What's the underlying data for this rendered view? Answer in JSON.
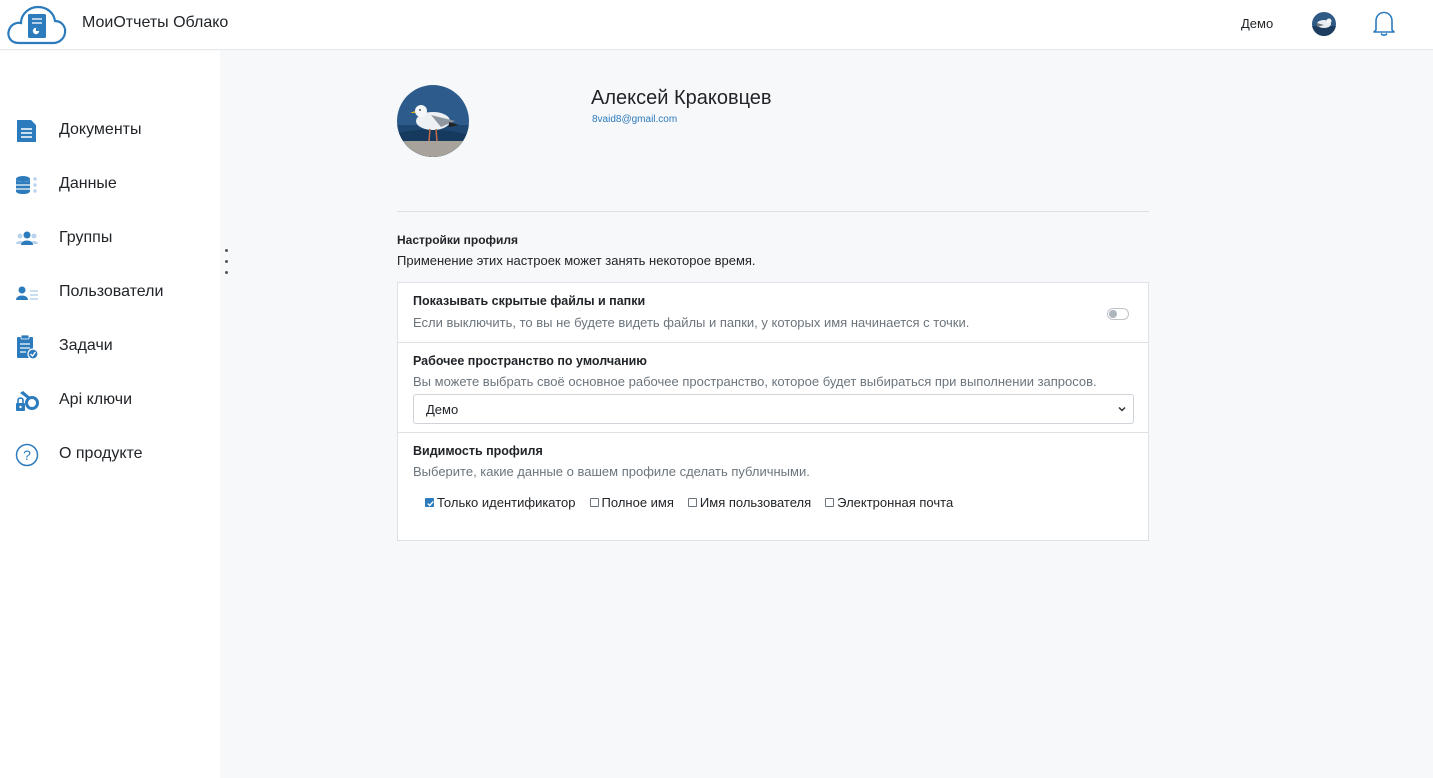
{
  "app": {
    "title": "МоиОтчеты Облако",
    "workspace": "Демо"
  },
  "sidebar": {
    "items": [
      {
        "label": "Документы",
        "icon": "document-icon"
      },
      {
        "label": "Данные",
        "icon": "database-icon"
      },
      {
        "label": "Группы",
        "icon": "group-icon"
      },
      {
        "label": "Пользователи",
        "icon": "users-icon"
      },
      {
        "label": "Задачи",
        "icon": "tasks-icon"
      },
      {
        "label": "Api ключи",
        "icon": "api-keys-icon"
      },
      {
        "label": "О продукте",
        "icon": "help-icon"
      }
    ]
  },
  "profile": {
    "name": "Алексей Краковцев",
    "email": "8vaid8@gmail.com"
  },
  "settings": {
    "title": "Настройки профиля",
    "subtitle": "Применение этих настроек может занять некоторое время.",
    "hidden_files": {
      "title": "Показывать скрытые файлы и папки",
      "description": "Если выключить, то вы не будете видеть файлы и папки, у которых имя начинается с точки.",
      "enabled": false
    },
    "default_workspace": {
      "title": "Рабочее пространство по умолчанию",
      "description": "Вы можете выбрать своё основное рабочее пространство, которое будет выбираться при выполнении запросов.",
      "selected": "Демо"
    },
    "visibility": {
      "title": "Видимость профиля",
      "description": "Выберите, какие данные о вашем профиле сделать публичными.",
      "options": [
        {
          "label": "Только идентификатор",
          "checked": true
        },
        {
          "label": "Полное имя",
          "checked": false
        },
        {
          "label": "Имя пользователя",
          "checked": false
        },
        {
          "label": "Электронная почта",
          "checked": false
        }
      ]
    }
  },
  "colors": {
    "accent": "#2b7bbd",
    "background": "#f7f8fa",
    "border": "#dee2e6"
  }
}
